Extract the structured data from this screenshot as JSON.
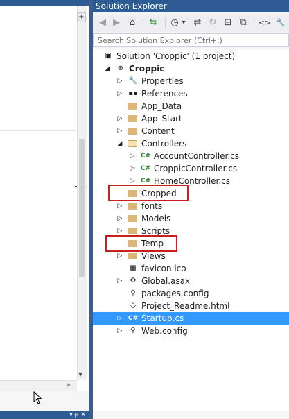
{
  "left_pane": {
    "split_glyph": "÷",
    "scroll_down_glyph": "▼",
    "scroll_right_glyph": "▶",
    "statusbar_glyphs": "▾ ᵽ ✕"
  },
  "panel": {
    "title": "Solution Explorer"
  },
  "toolbar": {
    "back_glyph": "◀",
    "forward_glyph": "▶",
    "home_glyph": "⌂",
    "sync_glyph": "⇆",
    "history_glyph": "◷",
    "history_dropdown_glyph": "▾",
    "swap_glyph": "⇄",
    "refresh_glyph": "↻",
    "collapse_glyph": "⊟",
    "copy_glyph": "⧉",
    "code_glyph": "<>",
    "wrench_glyph": "🔧"
  },
  "search": {
    "placeholder": "Search Solution Explorer (Ctrl+;)",
    "search_glyph": "⌕"
  },
  "tree": {
    "items": [
      {
        "label": "Solution 'Croppic' (1 project)",
        "arrow": "",
        "icon": "solution-icon",
        "glyph": "▣"
      },
      {
        "label": "Croppic",
        "arrow": "◢",
        "icon": "globe-project-icon",
        "glyph": "⊕"
      },
      {
        "label": "Properties",
        "arrow": "▷",
        "icon": "wrench-icon",
        "glyph": "🔧"
      },
      {
        "label": "References",
        "arrow": "▷",
        "icon": "references-icon",
        "glyph": "▪▪"
      },
      {
        "label": "App_Data",
        "arrow": "",
        "icon": "folder-icon",
        "glyph": ""
      },
      {
        "label": "App_Start",
        "arrow": "▷",
        "icon": "folder-icon",
        "glyph": ""
      },
      {
        "label": "Content",
        "arrow": "▷",
        "icon": "folder-icon",
        "glyph": ""
      },
      {
        "label": "Controllers",
        "arrow": "◢",
        "icon": "folder-open-icon",
        "glyph": ""
      },
      {
        "label": "AccountController.cs",
        "arrow": "▷",
        "icon": "csharp-file-icon",
        "glyph": "C#"
      },
      {
        "label": "CroppicController.cs",
        "arrow": "▷",
        "icon": "csharp-file-icon",
        "glyph": "C#"
      },
      {
        "label": "HomeController.cs",
        "arrow": "▷",
        "icon": "csharp-file-icon",
        "glyph": "C#"
      },
      {
        "label": "Cropped",
        "arrow": "",
        "icon": "folder-icon",
        "glyph": ""
      },
      {
        "label": "fonts",
        "arrow": "▷",
        "icon": "folder-icon",
        "glyph": ""
      },
      {
        "label": "Models",
        "arrow": "▷",
        "icon": "folder-icon",
        "glyph": ""
      },
      {
        "label": "Scripts",
        "arrow": "▷",
        "icon": "folder-icon",
        "glyph": ""
      },
      {
        "label": "Temp",
        "arrow": "",
        "icon": "folder-icon",
        "glyph": ""
      },
      {
        "label": "Views",
        "arrow": "▷",
        "icon": "folder-icon",
        "glyph": ""
      },
      {
        "label": "favicon.ico",
        "arrow": "",
        "icon": "image-file-icon",
        "glyph": "▦"
      },
      {
        "label": "Global.asax",
        "arrow": "▷",
        "icon": "gear-file-icon",
        "glyph": "⚙"
      },
      {
        "label": "packages.config",
        "arrow": "",
        "icon": "config-file-icon",
        "glyph": "⚲"
      },
      {
        "label": "Project_Readme.html",
        "arrow": "",
        "icon": "html-file-icon",
        "glyph": "◇"
      },
      {
        "label": "Startup.cs",
        "arrow": "▷",
        "icon": "csharp-file-icon",
        "glyph": "C#"
      },
      {
        "label": "Web.config",
        "arrow": "▷",
        "icon": "config-file-icon",
        "glyph": "⚲"
      }
    ],
    "selected_index": 21,
    "highlighted_labels": [
      "Cropped",
      "Temp"
    ]
  },
  "colors": {
    "accent": "#3399ff",
    "title_bar": "#2d5b94",
    "highlight_outline": "#c8201e",
    "folder": "#dcb67a",
    "csharp": "#2d8f2d"
  }
}
